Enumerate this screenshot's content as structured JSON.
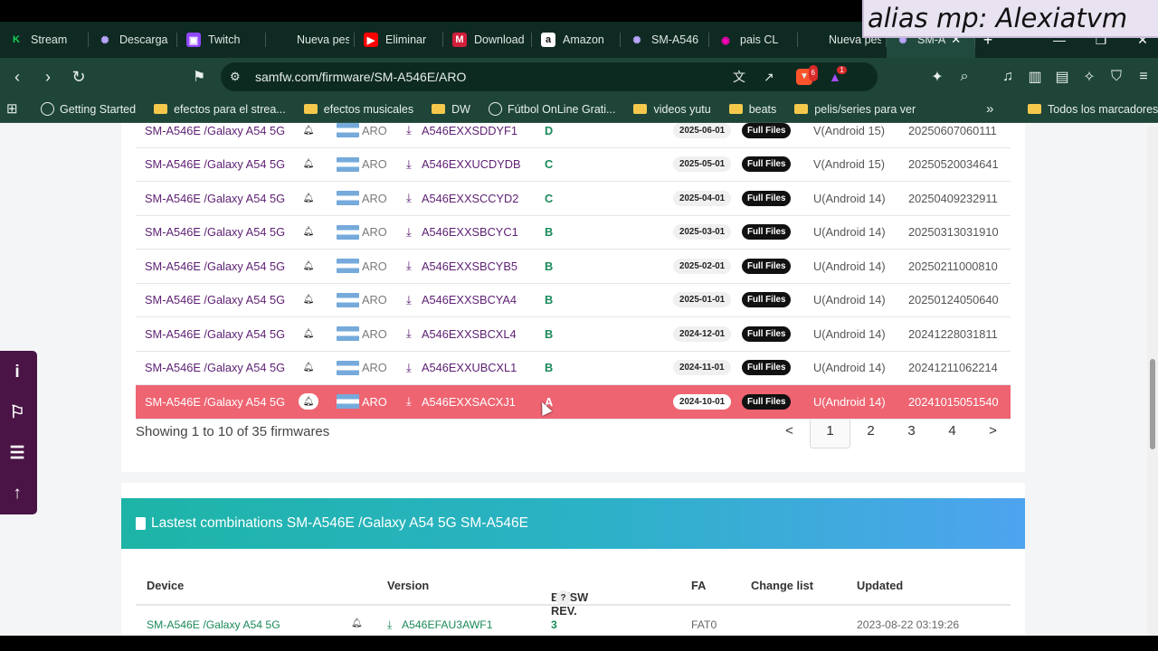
{
  "overlay": {
    "alias_text": "alias mp: Alexiatvm"
  },
  "tabs": [
    {
      "title": "Stream",
      "icon": "K",
      "icon_color": "#19d15a",
      "icon_bg": "transparent"
    },
    {
      "title": "Descarga",
      "icon": "✺",
      "icon_color": "#b9a6ff",
      "icon_bg": "transparent"
    },
    {
      "title": "Twitch",
      "icon": "▣",
      "icon_color": "#fff",
      "icon_bg": "#9147ff"
    },
    {
      "title": "Nueva pestaña",
      "icon": "",
      "icon_color": "#fff",
      "icon_bg": "transparent"
    },
    {
      "title": "Eliminar",
      "icon": "▶",
      "icon_color": "#fff",
      "icon_bg": "#f00"
    },
    {
      "title": "Download",
      "icon": "M",
      "icon_color": "#fff",
      "icon_bg": "#d21f3c"
    },
    {
      "title": "Amazon",
      "icon": "a",
      "icon_color": "#111",
      "icon_bg": "#fff"
    },
    {
      "title": "SM-A546",
      "icon": "✺",
      "icon_color": "#b9a6ff",
      "icon_bg": "transparent"
    },
    {
      "title": "pais CL",
      "icon": "◉",
      "icon_color": "#f0b",
      "icon_bg": "transparent"
    },
    {
      "title": "Nueva pestaña",
      "icon": "",
      "icon_color": "#fff",
      "icon_bg": "transparent"
    },
    {
      "title": "SM-A",
      "icon": "✺",
      "icon_color": "#b9a6ff",
      "icon_bg": "transparent",
      "active": true
    }
  ],
  "address": {
    "url": "samfw.com/firmware/SM-A546E/ARO",
    "shield_badge": "6",
    "rewards_badge": "1"
  },
  "bookmarks": [
    {
      "label": "Getting Started",
      "kind": "globe"
    },
    {
      "label": "efectos para el strea...",
      "kind": "folder"
    },
    {
      "label": "efectos musicales",
      "kind": "folder"
    },
    {
      "label": "DW",
      "kind": "folder"
    },
    {
      "label": "Fútbol OnLine Grati...",
      "kind": "globe"
    },
    {
      "label": "videos yutu",
      "kind": "folder"
    },
    {
      "label": "beats",
      "kind": "folder"
    },
    {
      "label": "pelis/series para ver",
      "kind": "folder"
    }
  ],
  "bookmarks_more": "»",
  "bookmarks_all": "Todos los marcadores",
  "firmware_rows": [
    {
      "device": "SM-A546E /Galaxy A54 5G",
      "region": "ARO",
      "pda": "A546EXXSDDYF1",
      "bit": "D",
      "date": "2025-06-01",
      "full": "Full Files",
      "os": "V(Android 15)",
      "build": "20250607060111"
    },
    {
      "device": "SM-A546E /Galaxy A54 5G",
      "region": "ARO",
      "pda": "A546EXXUCDYDB",
      "bit": "C",
      "date": "2025-05-01",
      "full": "Full Files",
      "os": "V(Android 15)",
      "build": "20250520034641"
    },
    {
      "device": "SM-A546E /Galaxy A54 5G",
      "region": "ARO",
      "pda": "A546EXXSCCYD2",
      "bit": "C",
      "date": "2025-04-01",
      "full": "Full Files",
      "os": "U(Android 14)",
      "build": "20250409232911"
    },
    {
      "device": "SM-A546E /Galaxy A54 5G",
      "region": "ARO",
      "pda": "A546EXXSBCYC1",
      "bit": "B",
      "date": "2025-03-01",
      "full": "Full Files",
      "os": "U(Android 14)",
      "build": "20250313031910"
    },
    {
      "device": "SM-A546E /Galaxy A54 5G",
      "region": "ARO",
      "pda": "A546EXXSBCYB5",
      "bit": "B",
      "date": "2025-02-01",
      "full": "Full Files",
      "os": "U(Android 14)",
      "build": "20250211000810"
    },
    {
      "device": "SM-A546E /Galaxy A54 5G",
      "region": "ARO",
      "pda": "A546EXXSBCYA4",
      "bit": "B",
      "date": "2025-01-01",
      "full": "Full Files",
      "os": "U(Android 14)",
      "build": "20250124050640"
    },
    {
      "device": "SM-A546E /Galaxy A54 5G",
      "region": "ARO",
      "pda": "A546EXXSBCXL4",
      "bit": "B",
      "date": "2024-12-01",
      "full": "Full Files",
      "os": "U(Android 14)",
      "build": "20241228031811"
    },
    {
      "device": "SM-A546E /Galaxy A54 5G",
      "region": "ARO",
      "pda": "A546EXXUBCXL1",
      "bit": "B",
      "date": "2024-11-01",
      "full": "Full Files",
      "os": "U(Android 14)",
      "build": "20241211062214"
    },
    {
      "device": "SM-A546E /Galaxy A54 5G",
      "region": "ARO",
      "pda": "A546EXXSACXJ1",
      "bit": "A",
      "date": "2024-10-01",
      "full": "Full Files",
      "os": "U(Android 14)",
      "build": "20241015051540",
      "highlight": true
    }
  ],
  "pagination": {
    "showing": "Showing 1 to 10 of 35 firmwares",
    "pages": [
      "<",
      "1",
      "2",
      "3",
      "4",
      ">"
    ],
    "active": "1"
  },
  "combinations": {
    "title": "Lastest combinations SM-A546E /Galaxy A54 5G SM-A546E",
    "headers": {
      "device": "Device",
      "version": "Version",
      "bit": "Bit/SW REV.",
      "help": "?",
      "fa": "FA",
      "changelist": "Change list",
      "updated": "Updated"
    },
    "row": {
      "device": "SM-A546E /Galaxy A54 5G",
      "version": "A546EFAU3AWF1",
      "bit": "3",
      "fa": "FAT0",
      "updated": "2023-08-22 03:19:26"
    }
  },
  "colors": {
    "brand_purple": "#5d1f73",
    "highlight_row": "#ee6471",
    "bit_green": "#1b8a5a"
  }
}
